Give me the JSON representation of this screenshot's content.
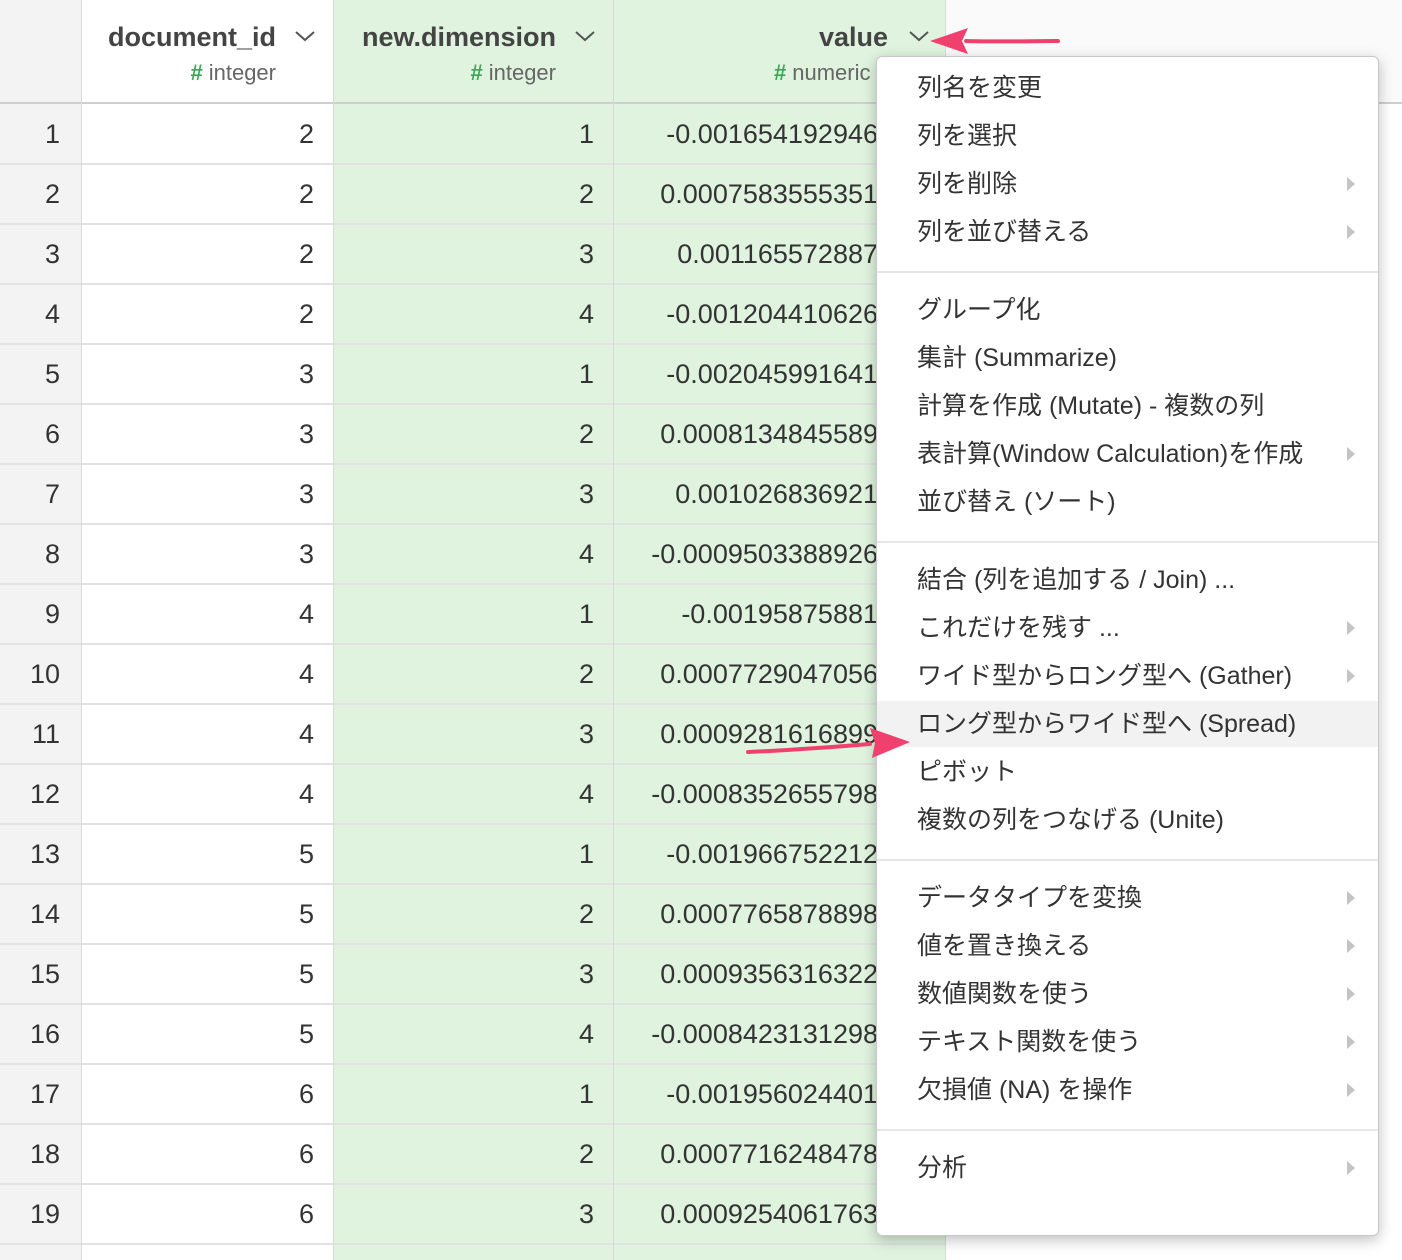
{
  "columns": [
    {
      "name": "document_id",
      "type": "integer"
    },
    {
      "name": "new.dimension",
      "type": "integer"
    },
    {
      "name": "value",
      "type": "numeric"
    }
  ],
  "type_hash": "#",
  "rows": [
    {
      "index": "1",
      "document_id": "2",
      "new_dimension": "1",
      "value": "-0.001654192946"
    },
    {
      "index": "2",
      "document_id": "2",
      "new_dimension": "2",
      "value": "0.0007583555351"
    },
    {
      "index": "3",
      "document_id": "2",
      "new_dimension": "3",
      "value": "0.001165572887"
    },
    {
      "index": "4",
      "document_id": "2",
      "new_dimension": "4",
      "value": "-0.001204410626"
    },
    {
      "index": "5",
      "document_id": "3",
      "new_dimension": "1",
      "value": "-0.002045991641"
    },
    {
      "index": "6",
      "document_id": "3",
      "new_dimension": "2",
      "value": "0.0008134845589"
    },
    {
      "index": "7",
      "document_id": "3",
      "new_dimension": "3",
      "value": "0.001026836921"
    },
    {
      "index": "8",
      "document_id": "3",
      "new_dimension": "4",
      "value": "-0.0009503388926"
    },
    {
      "index": "9",
      "document_id": "4",
      "new_dimension": "1",
      "value": "-0.00195875881"
    },
    {
      "index": "10",
      "document_id": "4",
      "new_dimension": "2",
      "value": "0.0007729047056"
    },
    {
      "index": "11",
      "document_id": "4",
      "new_dimension": "3",
      "value": "0.0009281616899"
    },
    {
      "index": "12",
      "document_id": "4",
      "new_dimension": "4",
      "value": "-0.0008352655798"
    },
    {
      "index": "13",
      "document_id": "5",
      "new_dimension": "1",
      "value": "-0.001966752212"
    },
    {
      "index": "14",
      "document_id": "5",
      "new_dimension": "2",
      "value": "0.0007765878898"
    },
    {
      "index": "15",
      "document_id": "5",
      "new_dimension": "3",
      "value": "0.0009356316322"
    },
    {
      "index": "16",
      "document_id": "5",
      "new_dimension": "4",
      "value": "-0.0008423131298"
    },
    {
      "index": "17",
      "document_id": "6",
      "new_dimension": "1",
      "value": "-0.001956024401"
    },
    {
      "index": "18",
      "document_id": "6",
      "new_dimension": "2",
      "value": "0.0007716248478"
    },
    {
      "index": "19",
      "document_id": "6",
      "new_dimension": "3",
      "value": "0.0009254061763"
    }
  ],
  "menu": {
    "groups": [
      [
        {
          "label": "列名を変更",
          "submenu": false
        },
        {
          "label": "列を選択",
          "submenu": false
        },
        {
          "label": "列を削除",
          "submenu": true
        },
        {
          "label": "列を並び替える",
          "submenu": true
        }
      ],
      [
        {
          "label": "グループ化",
          "submenu": false
        },
        {
          "label": "集計 (Summarize)",
          "submenu": false
        },
        {
          "label": "計算を作成 (Mutate) - 複数の列",
          "submenu": false
        },
        {
          "label": "表計算(Window Calculation)を作成",
          "submenu": true
        },
        {
          "label": "並び替え (ソート)",
          "submenu": false
        }
      ],
      [
        {
          "label": "結合 (列を追加する / Join) ...",
          "submenu": false
        },
        {
          "label": "これだけを残す ...",
          "submenu": true
        },
        {
          "label": "ワイド型からロング型へ (Gather)",
          "submenu": true
        },
        {
          "label": "ロング型からワイド型へ (Spread)",
          "submenu": false,
          "highlighted": true
        },
        {
          "label": "ピボット",
          "submenu": false
        },
        {
          "label": "複数の列をつなげる (Unite)",
          "submenu": false
        }
      ],
      [
        {
          "label": "データタイプを変換",
          "submenu": true
        },
        {
          "label": "値を置き換える",
          "submenu": true
        },
        {
          "label": "数値関数を使う",
          "submenu": true
        },
        {
          "label": "テキスト関数を使う",
          "submenu": true
        },
        {
          "label": "欠損値 (NA) を操作",
          "submenu": true
        }
      ],
      [
        {
          "label": "分析",
          "submenu": true
        }
      ]
    ]
  },
  "colors": {
    "selected_column_bg": "#dff3df",
    "type_hash": "#3aa655",
    "annotation_arrow": "#f0406e",
    "highlight_bg": "#f2f2f2"
  }
}
